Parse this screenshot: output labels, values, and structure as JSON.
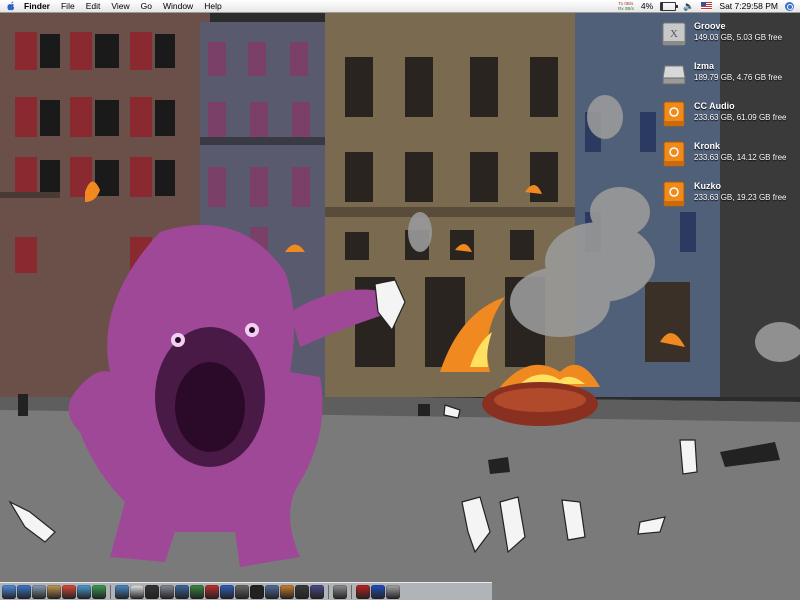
{
  "menubar": {
    "items": [
      "Finder",
      "File",
      "Edit",
      "View",
      "Go",
      "Window",
      "Help"
    ],
    "network": {
      "tx": "Tx 0B/s",
      "rx": "Rx 0B/s"
    },
    "battery_percent": "4%",
    "battery_level": "13%",
    "clock": "Sat 7:29:58 PM"
  },
  "drives": [
    {
      "name": "Groove",
      "info": "149.03 GB, 5.03 GB free",
      "icon": "internal-disk-x-icon"
    },
    {
      "name": "Izma",
      "info": "189.79 GB, 4.76 GB free",
      "icon": "internal-disk-icon"
    },
    {
      "name": "CC Audio",
      "info": "233.63 GB, 61.09 GB free",
      "icon": "firewire-disk-icon"
    },
    {
      "name": "Kronk",
      "info": "233.63 GB, 14.12 GB free",
      "icon": "firewire-disk-icon"
    },
    {
      "name": "Kuzko",
      "info": "233.63 GB, 19.23 GB free",
      "icon": "firewire-disk-icon"
    }
  ],
  "dock": {
    "apps": [
      {
        "name": "finder",
        "color": "#4f8fe0"
      },
      {
        "name": "safari",
        "color": "#3a7ad0"
      },
      {
        "name": "mail",
        "color": "#8aa0b8"
      },
      {
        "name": "address-book",
        "color": "#c89a50"
      },
      {
        "name": "ical",
        "color": "#e04a3a"
      },
      {
        "name": "iphoto",
        "color": "#4aa0d8"
      },
      {
        "name": "itunes",
        "color": "#3aa050"
      },
      {
        "name": "photoshop",
        "color": "#4a8ac8"
      },
      {
        "name": "textedit",
        "color": "#e8e8e8"
      },
      {
        "name": "terminal",
        "color": "#333333"
      },
      {
        "name": "system-preferences",
        "color": "#8a8a98"
      },
      {
        "name": "activity-monitor",
        "color": "#3a6aa0"
      },
      {
        "name": "dreamweaver",
        "color": "#3a8a40"
      },
      {
        "name": "bbedit",
        "color": "#c03030"
      },
      {
        "name": "adium",
        "color": "#3060c0"
      },
      {
        "name": "transmit",
        "color": "#6a6a6a"
      },
      {
        "name": "dvd-player",
        "color": "#222222"
      },
      {
        "name": "imovie",
        "color": "#5070a0"
      },
      {
        "name": "garageband",
        "color": "#d08030"
      },
      {
        "name": "logic",
        "color": "#3a3a3a"
      },
      {
        "name": "final-cut-pro",
        "color": "#4a4a8a"
      },
      {
        "name": "printer",
        "color": "#909090"
      },
      {
        "name": "folder-red",
        "color": "#c02020"
      },
      {
        "name": "folder-blue",
        "color": "#2050c0"
      },
      {
        "name": "trash",
        "color": "#a8a8a8"
      }
    ]
  }
}
